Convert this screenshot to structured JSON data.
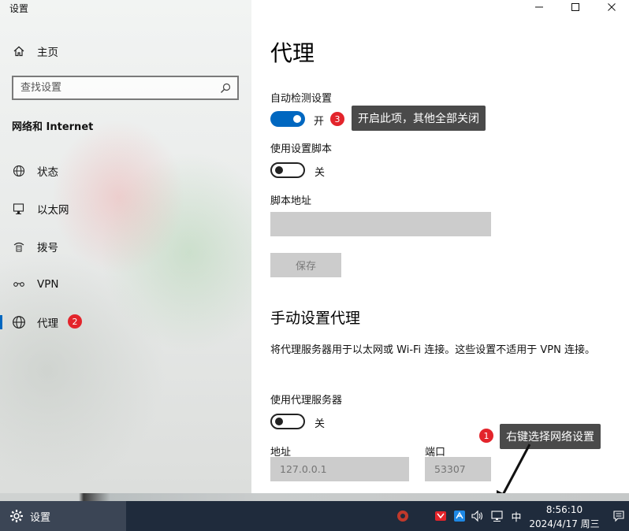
{
  "window": {
    "title": "设置"
  },
  "sidebar": {
    "home_label": "主页",
    "search_placeholder": "查找设置",
    "section_title": "网络和 Internet",
    "items": [
      {
        "label": "状态",
        "icon": "globe-status-icon"
      },
      {
        "label": "以太网",
        "icon": "ethernet-icon"
      },
      {
        "label": "拨号",
        "icon": "dialup-icon"
      },
      {
        "label": "VPN",
        "icon": "vpn-icon"
      },
      {
        "label": "代理",
        "icon": "globe-icon",
        "active": true,
        "badge": "2"
      }
    ]
  },
  "main": {
    "title": "代理",
    "auto_detect": {
      "label": "自动检测设置",
      "state_text": "开",
      "on": true,
      "badge": "3"
    },
    "use_script": {
      "label": "使用设置脚本",
      "state_text": "关",
      "on": false
    },
    "script_address": {
      "label": "脚本地址",
      "value": ""
    },
    "save_button": "保存",
    "manual_section": "手动设置代理",
    "manual_desc": "将代理服务器用于以太网或 Wi-Fi 连接。这些设置不适用于 VPN 连接。",
    "use_proxy": {
      "label": "使用代理服务器",
      "state_text": "关",
      "on": false
    },
    "address": {
      "label": "地址",
      "placeholder": "127.0.0.1"
    },
    "port": {
      "label": "端口",
      "placeholder": "53307"
    }
  },
  "annotations": {
    "callout_top": "开启此项，其他全部关闭",
    "callout_bottom": "右键选择网络设置",
    "badge_bottom": "1"
  },
  "taskbar": {
    "app_label": "设置",
    "ime": "中",
    "time": "8:56:10",
    "date": "2024/4/17 周三"
  },
  "colors": {
    "accent": "#0067c0",
    "badge": "#e3242b",
    "callout": "#4a4a4a",
    "taskbar": "#1f2b3c"
  }
}
